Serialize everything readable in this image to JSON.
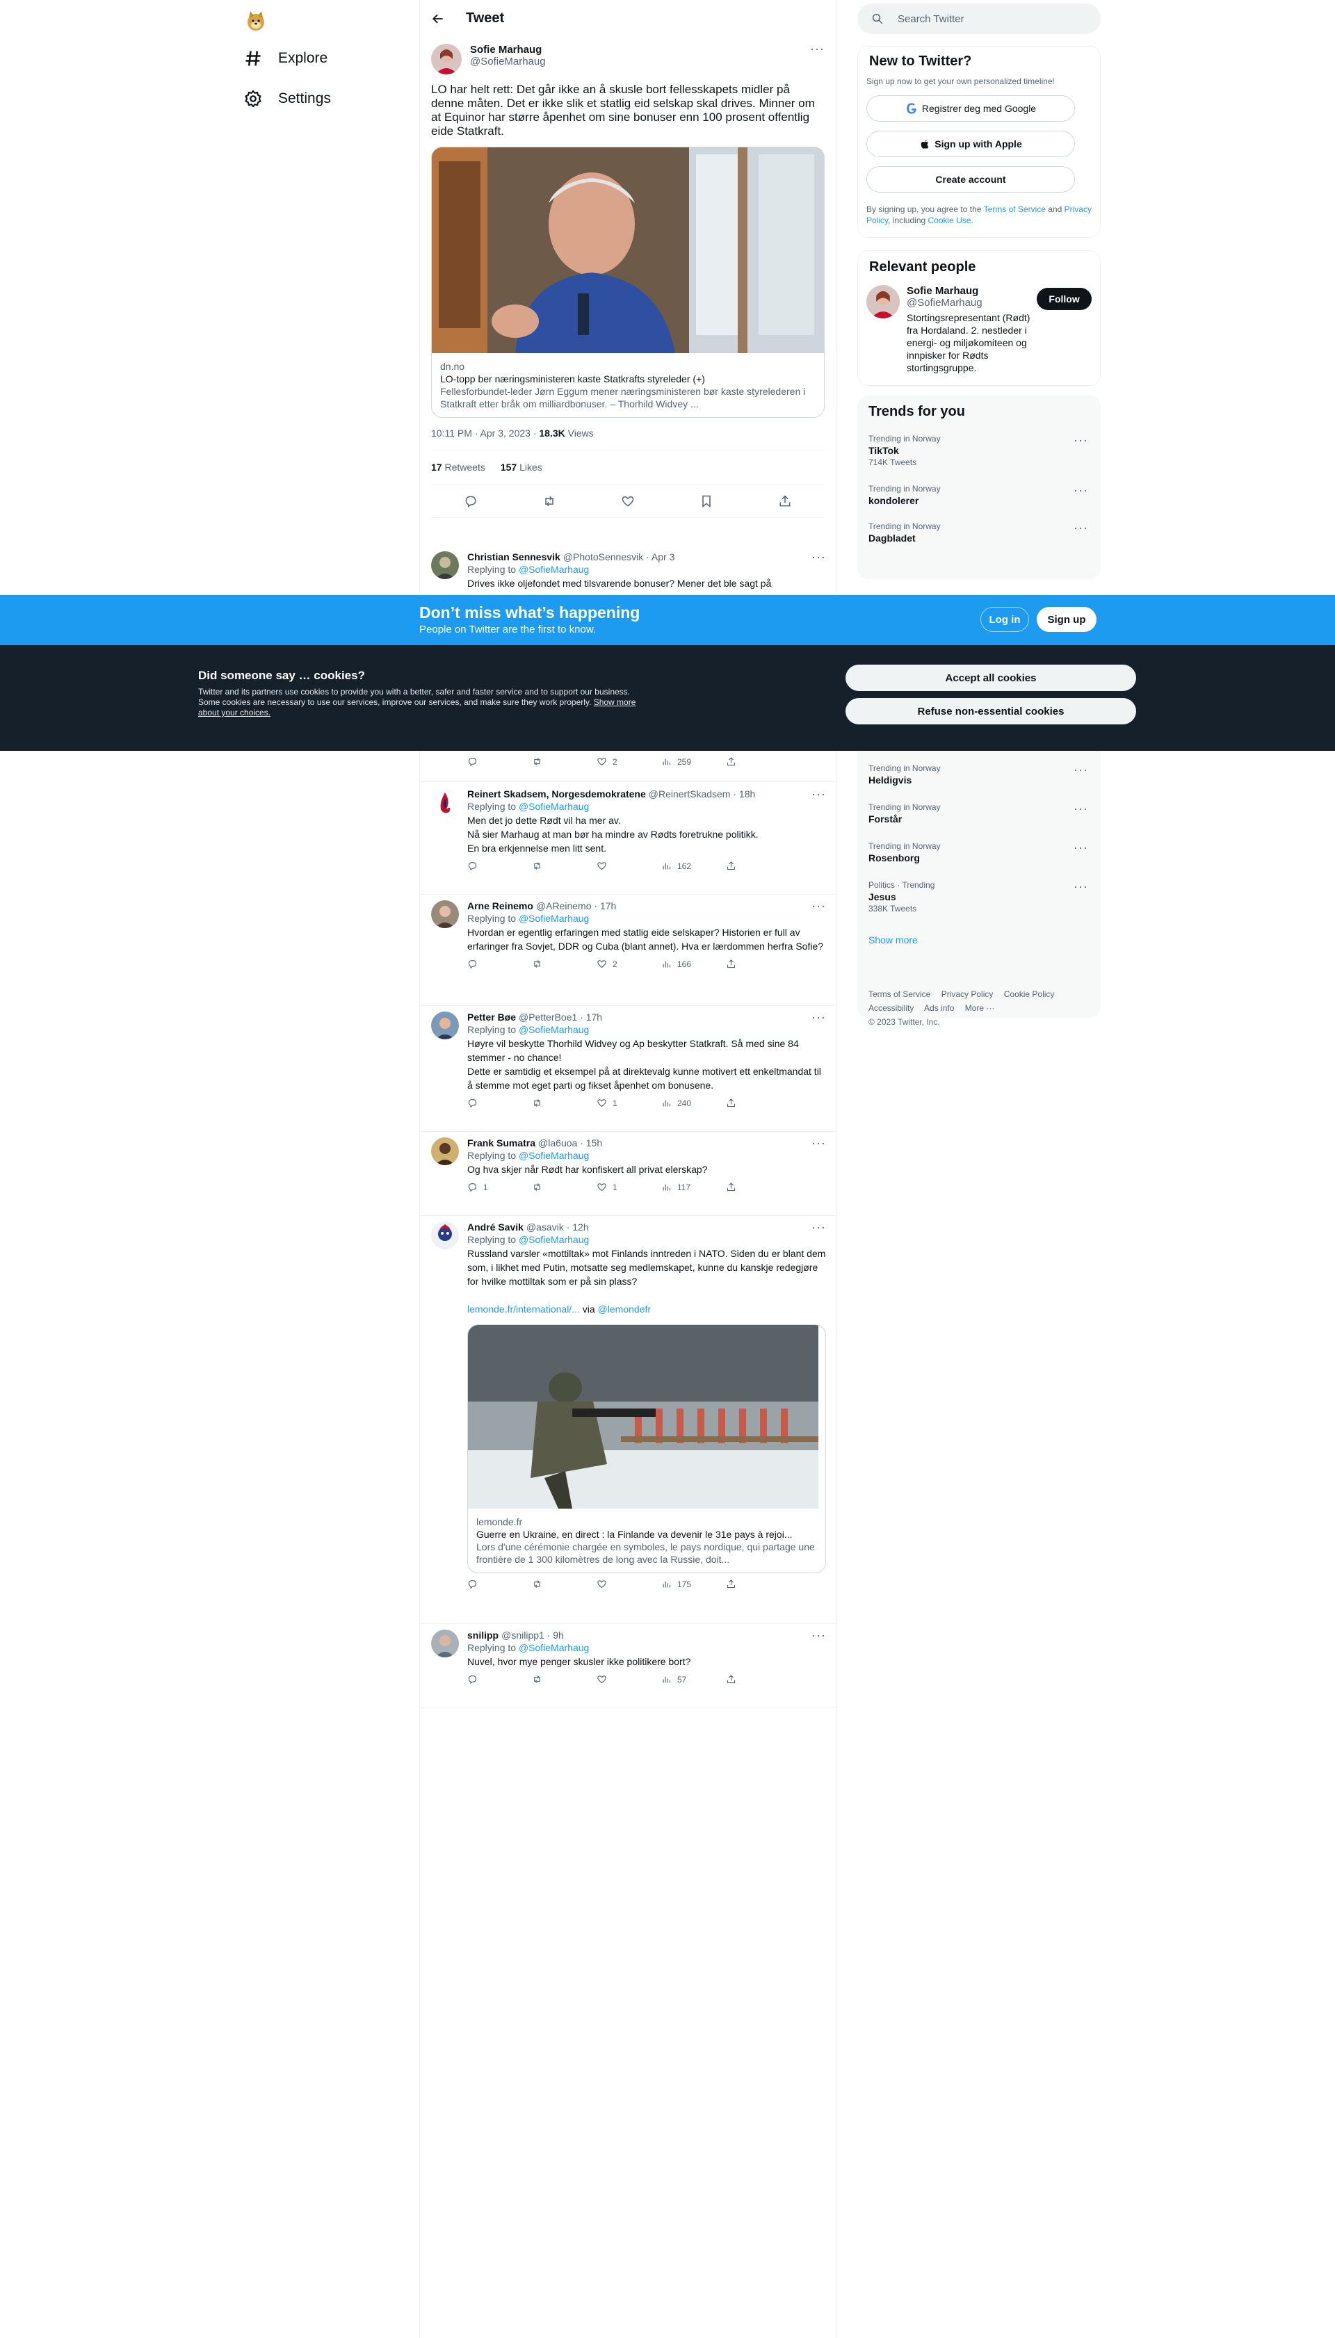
{
  "nav": {
    "explore": "Explore",
    "settings": "Settings"
  },
  "header": {
    "title": "Tweet"
  },
  "tweet": {
    "name": "Sofie Marhaug",
    "handle": "@SofieMarhaug",
    "text": "LO har helt rett: Det går ikke an å skusle bort fellesskapets midler på denne måten. Det er ikke slik et statlig eid selskap skal drives. Minner om at Equinor har større åpenhet om sine bonuser enn 100 prosent offentlig eide Statkraft.",
    "card": {
      "domain": "dn.no",
      "title": "LO-topp ber næringsministeren kaste Statkrafts styreleder (+)",
      "desc": "Fellesforbundet-leder Jørn Eggum mener næringsministeren bør kaste styrelederen i Statkraft etter bråk om milliardbonuser. – Thorhild Widvey ..."
    },
    "time": "10:11 PM · Apr 3, 2023 · ",
    "views": "18.3K",
    "views_label": "Views",
    "retweets": "17",
    "retweets_label": "Retweets",
    "likes": "157",
    "likes_label": "Likes"
  },
  "replies": [
    {
      "name": "Christian Sennesvik",
      "handle": "@PhotoSennesvik · Apr 3",
      "replying": "Replying to ",
      "mention": "@SofieMarhaug",
      "text": "Drives ikke oljefondet med tilsvarende bonuser? Mener det ble sagt på"
    },
    {
      "likes": "2",
      "views": "259"
    },
    {
      "name": "Reinert Skadsem, Norgesdemokratene",
      "handle": "@ReinertSkadsem · 18h",
      "replying": "Replying to ",
      "mention": "@SofieMarhaug",
      "text1": "Men det jo dette Rødt vil ha mer av.",
      "text2": "Nå sier Marhaug at man bør ha mindre av Rødts foretrukne politikk.",
      "text3": "En bra erkjennelse men litt sent.",
      "views": "162"
    },
    {
      "name": "Arne Reinemo",
      "handle": "@AReinemo · 17h",
      "replying": "Replying to ",
      "mention": "@SofieMarhaug",
      "text": "Hvordan er egentlig erfaringen med statlig eide selskaper? Historien er full av erfaringer fra Sovjet, DDR og Cuba (blant annet). Hva er lærdommen herfra Sofie?",
      "likes": "2",
      "views": "166"
    },
    {
      "name": "Petter Bøe",
      "handle": "@PetterBoe1 · 17h",
      "replying": "Replying to ",
      "mention": "@SofieMarhaug",
      "text1": "Høyre vil beskytte Thorhild Widvey og Ap beskytter Statkraft. Så med sine 84 stemmer - no chance!",
      "text2": "Dette er samtidig et eksempel på at direktevalg kunne motivert ett enkeltmandat til å stemme mot eget parti og fikset åpenhet om bonusene.",
      "likes": "1",
      "views": "240"
    },
    {
      "name": "Frank Sumatra",
      "handle": "@la6uoa · 15h",
      "replying": "Replying to ",
      "mention": "@SofieMarhaug",
      "text": "Og hva skjer når Rødt har konfiskert all privat elerskap?",
      "replies": "1",
      "likes": "1",
      "views": "117"
    },
    {
      "name": "André Savik",
      "handle": "@asavik · 12h",
      "replying": "Replying to ",
      "mention": "@SofieMarhaug",
      "text": "Russland varsler «mottiltak» mot Finlands inntreden i NATO. Siden du er blant dem som, i likhet med Putin,  motsatte seg medlemskapet, kunne du kanskje redegjøre for hvilke mottiltak som er på sin plass?",
      "link": "lemonde.fr/international/...",
      "via": " via ",
      "via_handle": "@lemondefr",
      "card": {
        "domain": "lemonde.fr",
        "title": "Guerre en Ukraine, en direct : la Finlande va devenir le 31e pays à rejoi...",
        "desc": "Lors d'une cérémonie chargée en symboles, le pays nordique, qui partage une frontière de 1 300 kilomètres de long avec la Russie, doit..."
      },
      "views": "175"
    },
    {
      "name": "snilipp",
      "handle": "@snilipp1 · 9h",
      "replying": "Replying to ",
      "mention": "@SofieMarhaug",
      "text": "Nuvel, hvor mye penger skusler ikke politikere bort?",
      "views": "57"
    }
  ],
  "sidebar": {
    "search_placeholder": "Search Twitter",
    "new_title": "New to Twitter?",
    "new_sub": "Sign up now to get your own personalized timeline!",
    "google": "Registrer deg med Google",
    "apple": "Sign up with Apple",
    "create": "Create account",
    "legal1": "By signing up, you agree to the ",
    "tos": "Terms of Service",
    "and": " and ",
    "privacy": "Privacy Policy",
    "including": ", including ",
    "cookie": "Cookie Use",
    "dot": ".",
    "relevant_title": "Relevant people",
    "person_name": "Sofie Marhaug",
    "person_handle": "@SofieMarhaug",
    "follow": "Follow",
    "person_bio": "Stortingsrepresentant (Rødt) fra Hordaland. 2. nestleder i energi- og miljøkomiteen og innpisker for Rødts stortingsgruppe.",
    "trends_title": "Trends for you",
    "trends": [
      {
        "ctx": "Trending in Norway",
        "title": "TikTok",
        "count": "714K Tweets"
      },
      {
        "ctx": "Trending in Norway",
        "title": "kondolerer"
      },
      {
        "ctx": "Trending in Norway",
        "title": "Dagbladet"
      },
      {
        "ctx": "Trending in Norway",
        "title": "Heldigvis"
      },
      {
        "ctx": "Trending in Norway",
        "title": "Forstår"
      },
      {
        "ctx": "Trending in Norway",
        "title": "Rosenborg"
      },
      {
        "ctx": "Politics · Trending",
        "title": "Jesus",
        "count": "338K Tweets"
      }
    ],
    "show_more": "Show more",
    "footer": {
      "tos": "Terms of Service",
      "privacy": "Privacy Policy",
      "cookie": "Cookie Policy",
      "access": "Accessibility",
      "ads": "Ads info",
      "more": "More ···",
      "copy": "© 2023 Twitter, Inc."
    }
  },
  "banner": {
    "heading": "Don’t miss what’s happening",
    "sub": "People on Twitter are the first to know.",
    "login": "Log in",
    "signup": "Sign up"
  },
  "cookies": {
    "heading": "Did someone say … cookies?",
    "text": "Twitter and its partners use cookies to provide you with a better, safer and faster service and to support our business. Some cookies are necessary to use our services, improve our services, and make sure they work properly. ",
    "link": "Show more about your choices.",
    "accept": "Accept all cookies",
    "refuse": "Refuse non-essential cookies"
  },
  "colors": {
    "accent": "#1d9bf0",
    "dark": "#0f1419",
    "cookie_bg": "#15202b"
  }
}
